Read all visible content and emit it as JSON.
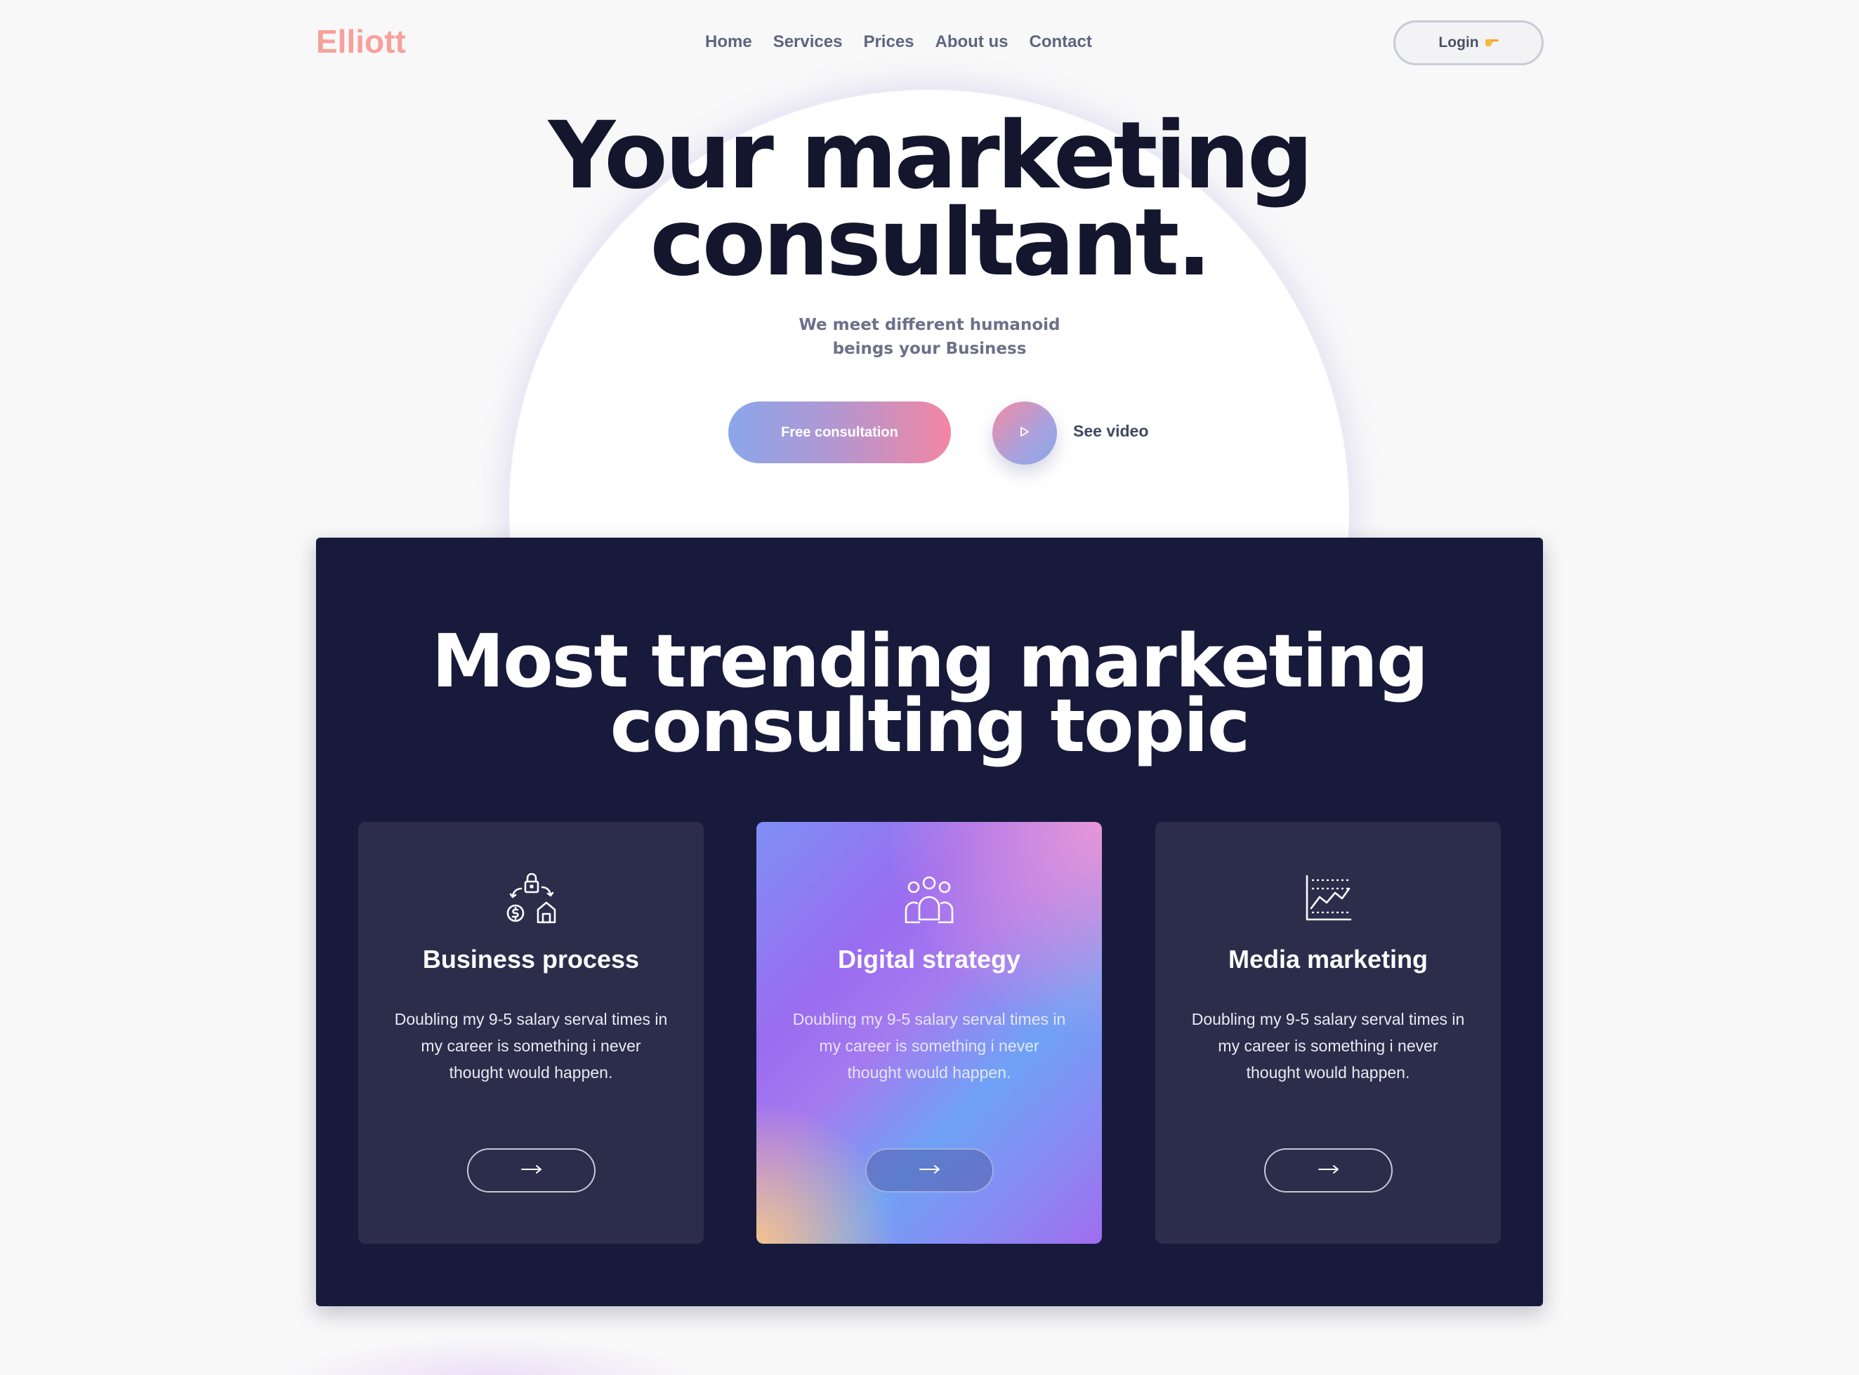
{
  "brand": {
    "logo": "Elliott"
  },
  "nav": {
    "items": [
      {
        "label": "Home"
      },
      {
        "label": "Services"
      },
      {
        "label": "Prices"
      },
      {
        "label": "About us"
      },
      {
        "label": "Contact"
      }
    ],
    "login_label": "Login",
    "login_icon": "pointing-hand-icon"
  },
  "hero": {
    "title_line1": "Your marketing",
    "title_line2": "consultant.",
    "subtitle_line1": "We meet different humanoid",
    "subtitle_line2": "beings your Business",
    "cta_label": "Free consultation",
    "video_label": "See video",
    "play_icon": "play-icon"
  },
  "section": {
    "title_line1": "Most trending marketing",
    "title_line2": "consulting topic",
    "cards": [
      {
        "icon": "business-process-icon",
        "title": "Business process",
        "text": "Doubling my 9-5 salary serval times in my career is something i never thought would happen.",
        "arrow_icon": "arrow-right-icon"
      },
      {
        "icon": "team-people-icon",
        "title": "Digital strategy",
        "text": "Doubling my 9-5 salary serval times in my career is something i never thought would happen.",
        "arrow_icon": "arrow-right-icon"
      },
      {
        "icon": "chart-growth-icon",
        "title": "Media marketing",
        "text": "Doubling my 9-5 salary serval times in my career is something i never thought would happen.",
        "arrow_icon": "arrow-right-icon"
      }
    ]
  },
  "colors": {
    "logo": "#f6a19a",
    "dark_section": "#181a3b",
    "card": "#2b2d4b",
    "heading": "#13162c",
    "nav_text": "#5d6580"
  }
}
